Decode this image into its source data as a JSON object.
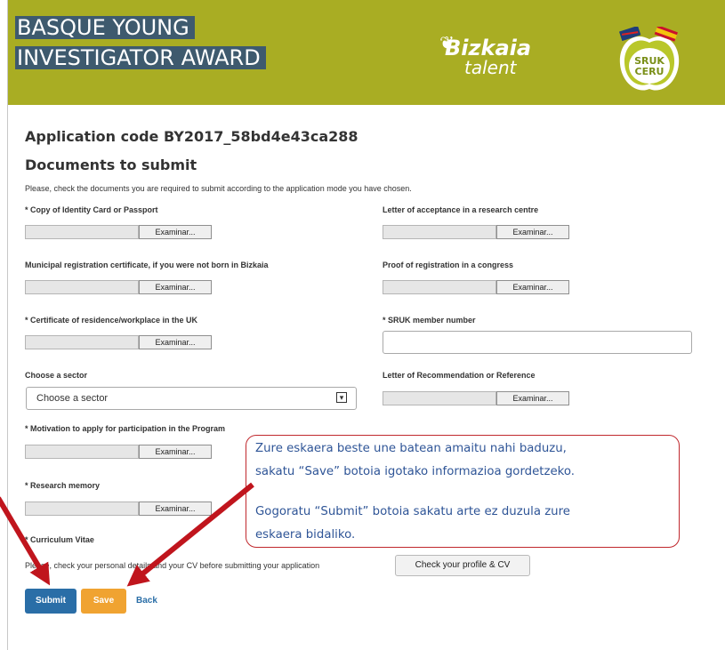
{
  "header": {
    "brand_line1": "BASQUE YOUNG",
    "brand_line2": "INVESTIGATOR AWARD",
    "bizkaia_title": "Bizkaia",
    "bizkaia_sub": "talent",
    "sruk_line1": "SRUK",
    "sruk_line2": "CERU"
  },
  "app_code": "Application code BY2017_58bd4e43ca288",
  "docs_title": "Documents to submit",
  "intro": "Please, check the documents you are required to submit according to the application mode you have chosen.",
  "file_button_label": "Examinar...",
  "left": {
    "identity": "* Copy of Identity Card or Passport",
    "municipal": "Municipal registration certificate, if you were not born in Bizkaia",
    "residence": "* Certificate of residence/workplace in the UK",
    "sector_label": "Choose a sector",
    "sector_value": "Choose a sector",
    "motivation": "* Motivation to apply for participation in the Program",
    "research": "* Research memory",
    "cv": "* Curriculum Vitae"
  },
  "right": {
    "acceptance": "Letter of acceptance in a research centre",
    "congress": "Proof of registration in a congress",
    "sruk_member": "* SRUK member number",
    "recommendation": "Letter of Recommendation or Reference"
  },
  "profile_text": "Please, check your personal details and your CV before submitting your application",
  "profile_button": "Check your profile & CV",
  "actions": {
    "submit": "Submit",
    "save": "Save",
    "back": "Back"
  },
  "callout": {
    "line1": "Zure eskaera beste une batean amaitu nahi baduzu,",
    "line2": "sakatu “Save” botoia igotako informazioa gordetzeko.",
    "line3": "Gogoratu “Submit” botoia sakatu arte ez duzula zure",
    "line4": "eskaera bidaliko."
  },
  "colors": {
    "header_bg": "#a9ad23",
    "brand_box": "#3e5a6e",
    "submit": "#2a6ea7",
    "save": "#f0a331",
    "callout_border": "#c0282d",
    "callout_text": "#2f5597",
    "arrow": "#c0151d"
  },
  "icons": {
    "select_chevron": "chevron-down-icon",
    "bizkaia_leaf": "leaf-icon",
    "sruk_logo": "apple-flags-logo"
  }
}
